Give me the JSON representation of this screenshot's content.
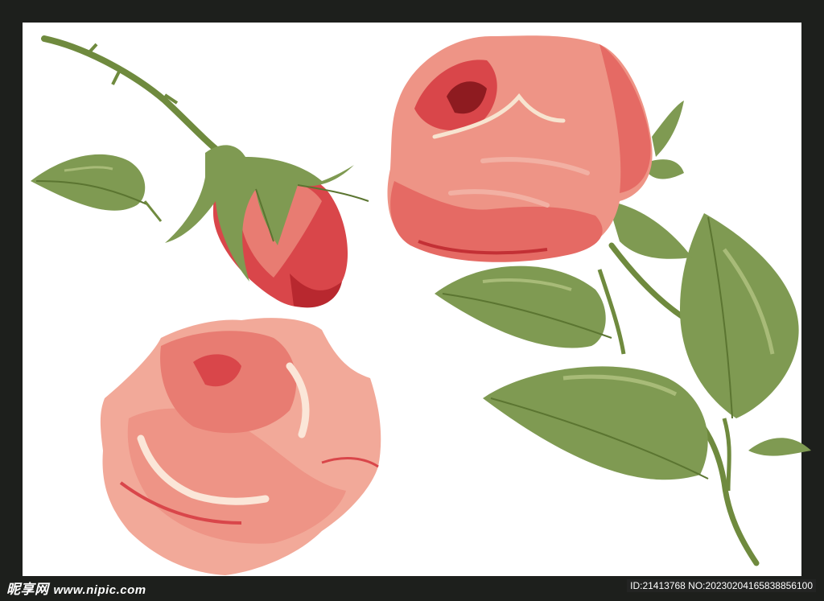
{
  "watermark": {
    "logo_text": "昵享网",
    "site_text": "www.nipic.com",
    "id_text": "ID:21413768 NO:20230204165838856100"
  },
  "colors": {
    "frame": "#1d1f1c",
    "background": "#ffffff",
    "rose_red": "#d9464a",
    "rose_pink": "#ef9a8c",
    "leaf_green": "#7f9a52"
  }
}
